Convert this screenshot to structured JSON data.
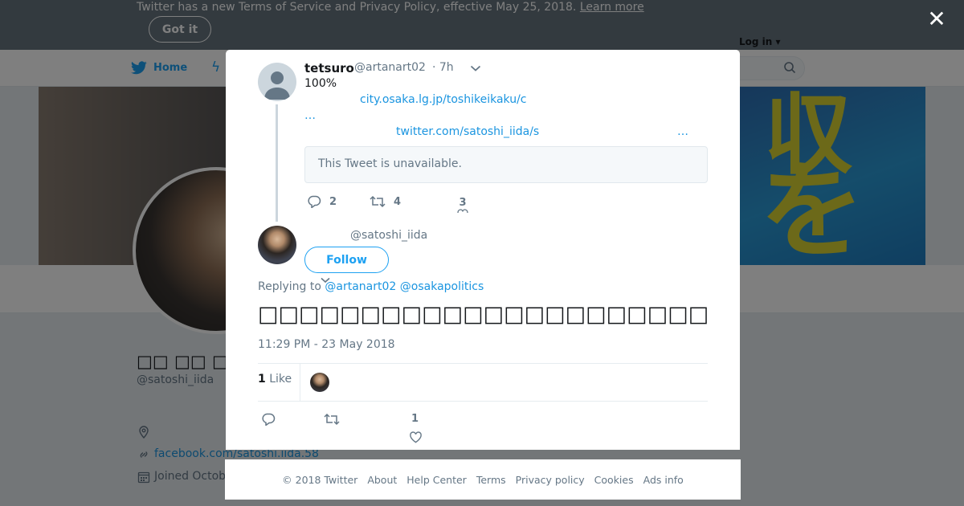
{
  "tos_banner": {
    "text": "Twitter has a new Terms of Service and Privacy Policy, effective May 25, 2018.",
    "learn_more": "Learn more",
    "got_it": "Got it"
  },
  "nav": {
    "home_label": "Home",
    "login_label": "Log in"
  },
  "profile": {
    "name": "□□ □□ □□□",
    "handle": "@satoshi_iida",
    "website": "facebook.com/satoshi.iida.58",
    "joined": "Joined Octob"
  },
  "parent_tweet": {
    "name": "tetsuro",
    "handle": "@artanart02",
    "time": "· 7h",
    "text": "100%",
    "link1": "city.osaka.lg.jp/toshikeikaku/c",
    "ellipsis1": "…",
    "link2": "twitter.com/satoshi_iida/s",
    "ellipsis2": "…",
    "quote_text": "This Tweet is unavailable.",
    "reply_count": "2",
    "retweet_count": "4",
    "like_count": "3"
  },
  "main_tweet": {
    "handle": "@satoshi_iida",
    "follow_label": "Follow",
    "replying_prefix": "Replying to",
    "reply_to_1": "@artanart02",
    "reply_to_2": "@osakapolitics",
    "text": "□□□□□□□□□□□□□□□□□□□□□□",
    "timestamp": "11:29 PM - 23 May 2018",
    "likes_count": "1",
    "likes_label": "Like",
    "like_count": "1"
  },
  "footer": {
    "copyright": "© 2018 Twitter",
    "about": "About",
    "help": "Help Center",
    "terms": "Terms",
    "privacy": "Privacy policy",
    "cookies": "Cookies",
    "ads": "Ads info"
  },
  "colors": {
    "accent": "#1da1f2",
    "link": "#1b95e0",
    "muted": "#657786"
  }
}
